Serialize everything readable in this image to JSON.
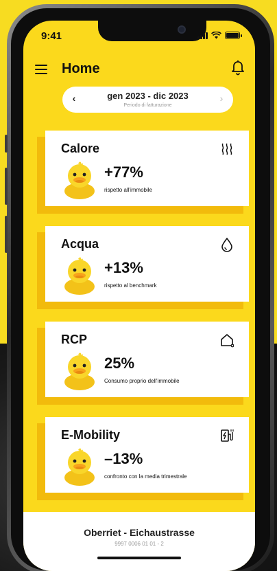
{
  "status_bar": {
    "time": "9:41"
  },
  "header": {
    "title": "Home"
  },
  "period": {
    "range": "gen 2023 - dic 2023",
    "label": "Periodo di fatturazione",
    "prev_arrow": "‹",
    "next_arrow": "›"
  },
  "cards": [
    {
      "title": "Calore",
      "value": "+77%",
      "description": "rispetto all'immobile",
      "icon": "heat-icon"
    },
    {
      "title": "Acqua",
      "value": "+13%",
      "description": "rispetto al benchmark",
      "icon": "water-drop-icon"
    },
    {
      "title": "RCP",
      "value": "25%",
      "description": "Consumo proprio dell'immobile",
      "icon": "house-icon"
    },
    {
      "title": "E-Mobility",
      "value": "–13%",
      "description": "confronto con la media trimestrale",
      "icon": "ev-charger-icon"
    }
  ],
  "footer": {
    "location": "Oberriet - Eichaustrasse",
    "id": "9997 0006 01 01 - 2"
  },
  "colors": {
    "brand_yellow": "#fbd91c",
    "card_shadow": "#f2bb0c",
    "duck_yellow": "#f9d62a",
    "beak_orange": "#f7a21b"
  }
}
